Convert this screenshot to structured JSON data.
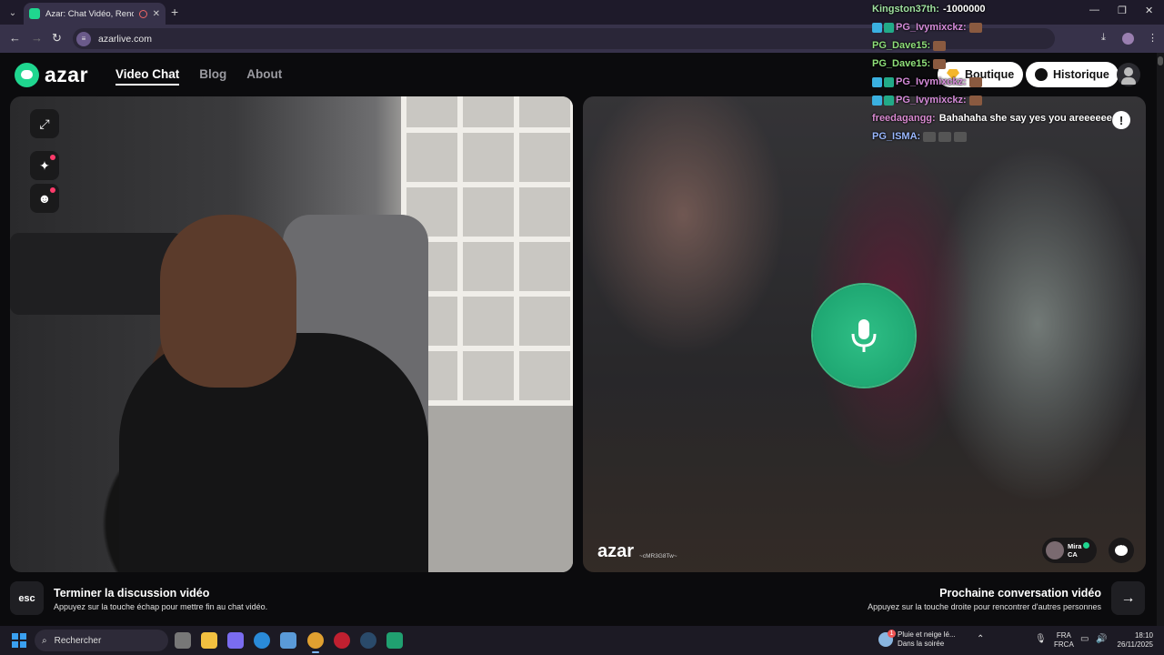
{
  "browser": {
    "tab_title": "Azar: Chat Vidéo, Rencontr",
    "url": "azarlive.com"
  },
  "header": {
    "logo": "azar",
    "nav": [
      {
        "label": "Video Chat",
        "active": true
      },
      {
        "label": "Blog",
        "active": false
      },
      {
        "label": "About",
        "active": false
      }
    ],
    "shop_label": "Boutique",
    "history_label": "Historique"
  },
  "video": {
    "watermark": "azar",
    "watermark_code": "~cMR3G8Tw~",
    "partner_name": "Mira",
    "partner_country": "CA",
    "report_icon": "!"
  },
  "footer": {
    "esc_key": "esc",
    "end_title": "Terminer la discussion vidéo",
    "end_sub": "Appuyez sur la touche échap pour mettre fin au chat vidéo.",
    "next_title": "Prochaine conversation vidéo",
    "next_sub": "Appuyez sur la touche droite pour rencontrer d'autres personnes",
    "next_icon": "→"
  },
  "overlay_chat": [
    {
      "user": "Kingston37th:",
      "message": "-1000000",
      "color": "#9fe0a0"
    },
    {
      "user": "PG_Ivymixckz:",
      "message": "",
      "color": "#d48ad8"
    },
    {
      "user": "PG_Dave15:",
      "message": "",
      "color": "#8fe07a"
    },
    {
      "user": "PG_Dave15:",
      "message": "",
      "color": "#8fe07a"
    },
    {
      "user": "PG_Ivymixckz:",
      "message": "",
      "color": "#d48ad8"
    },
    {
      "user": "PG_Ivymixckz:",
      "message": "",
      "color": "#d48ad8"
    },
    {
      "user": "freedagangg:",
      "message": "Bahahaha she say yes you areeeeee",
      "color": "#d88ad0"
    },
    {
      "user": "PG_ISMA:",
      "message": "",
      "color": "#9ab8ff"
    }
  ],
  "taskbar": {
    "search_label": "Rechercher",
    "weather_line1": "Pluie et neige lé...",
    "weather_line2": "Dans la soirée",
    "lang_line1": "FRA",
    "lang_line2": "FRCA",
    "time": "18:10",
    "date": "26/11/2025"
  },
  "colors": {
    "accent": "#1fd68f",
    "mic": "#26b67d"
  }
}
